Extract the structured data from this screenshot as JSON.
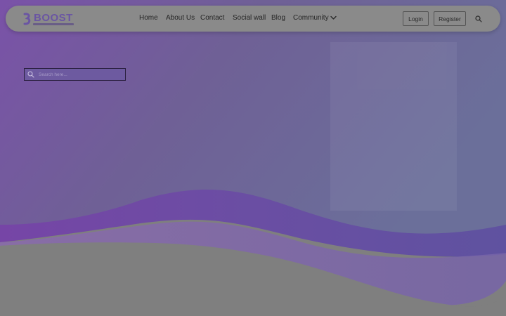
{
  "brand": {
    "name": "BOOST",
    "tagline": "",
    "color": "#6a55a3"
  },
  "nav": {
    "items": [
      {
        "label": "Home"
      },
      {
        "label": "About Us"
      },
      {
        "label": "Contact"
      },
      {
        "label": "Social wall"
      },
      {
        "label": "Blog"
      },
      {
        "label": "Community",
        "has_dropdown": true,
        "icon": "chevron-down-icon"
      }
    ],
    "login_label": "Login",
    "register_label": "Register",
    "search_icon": "search-icon"
  },
  "hero": {
    "search": {
      "placeholder": "Search here...",
      "value": "",
      "icon": "search-icon"
    }
  },
  "colors": {
    "hero_purple": "#6a54a0",
    "overlay_gray": "#7f7f7f"
  }
}
